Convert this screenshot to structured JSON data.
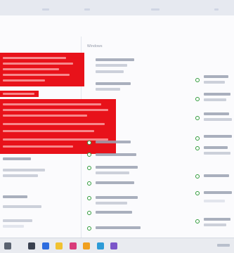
{
  "window": {
    "right_panel_heading": "Windows"
  },
  "colors": {
    "redaction": "#e8121a",
    "radio": "#2f9a3a",
    "taskbar": "#e9ebf0"
  },
  "taskbar": {
    "icons": [
      "start-icon",
      "search-icon",
      "task-view-icon",
      "file-explorer-icon",
      "browser-icon",
      "mail-icon",
      "store-icon",
      "photos-icon"
    ]
  }
}
